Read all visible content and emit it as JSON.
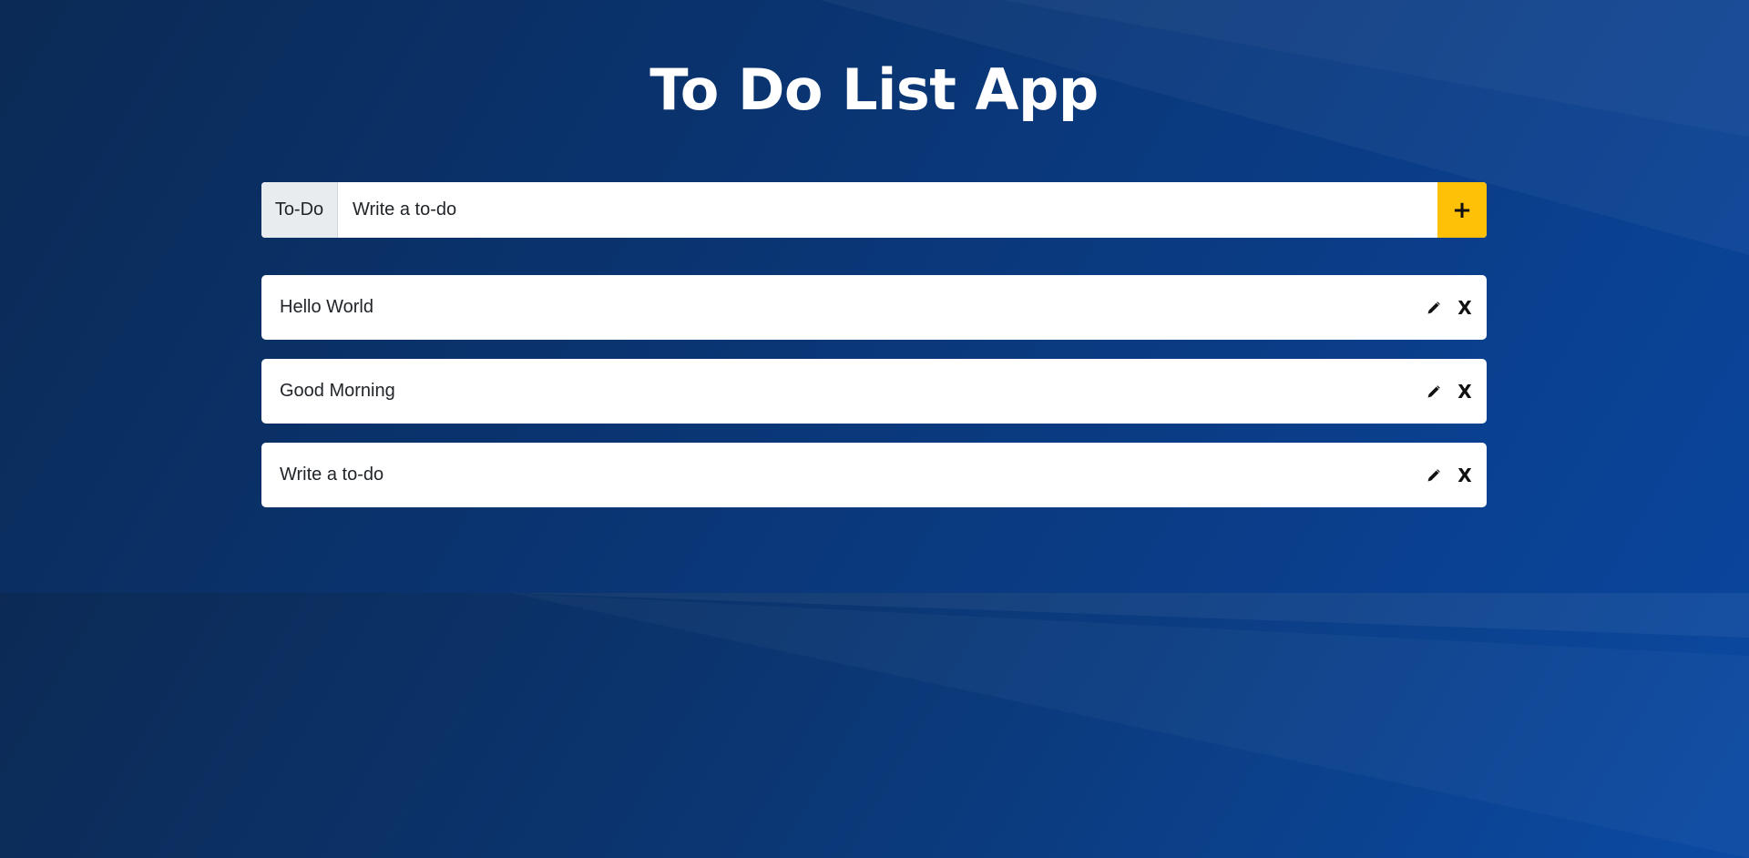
{
  "app": {
    "title": "To Do List App"
  },
  "form": {
    "prefix_label": "To-Do",
    "input_value": "",
    "input_placeholder": "Write a to-do",
    "add_label": "+"
  },
  "todos": [
    {
      "text": "Hello World",
      "edit_icon": "pencil-icon",
      "delete_label": "X"
    },
    {
      "text": "Good Morning",
      "edit_icon": "pencil-icon",
      "delete_label": "X"
    },
    {
      "text": "Write a to-do",
      "edit_icon": "pencil-icon",
      "delete_label": "X"
    }
  ],
  "colors": {
    "background_dark": "#0b2a55",
    "background_light": "#0a47a1",
    "accent": "#ffc107",
    "card": "#ffffff",
    "prefix_bg": "#e9ecef",
    "text": "#212529"
  }
}
